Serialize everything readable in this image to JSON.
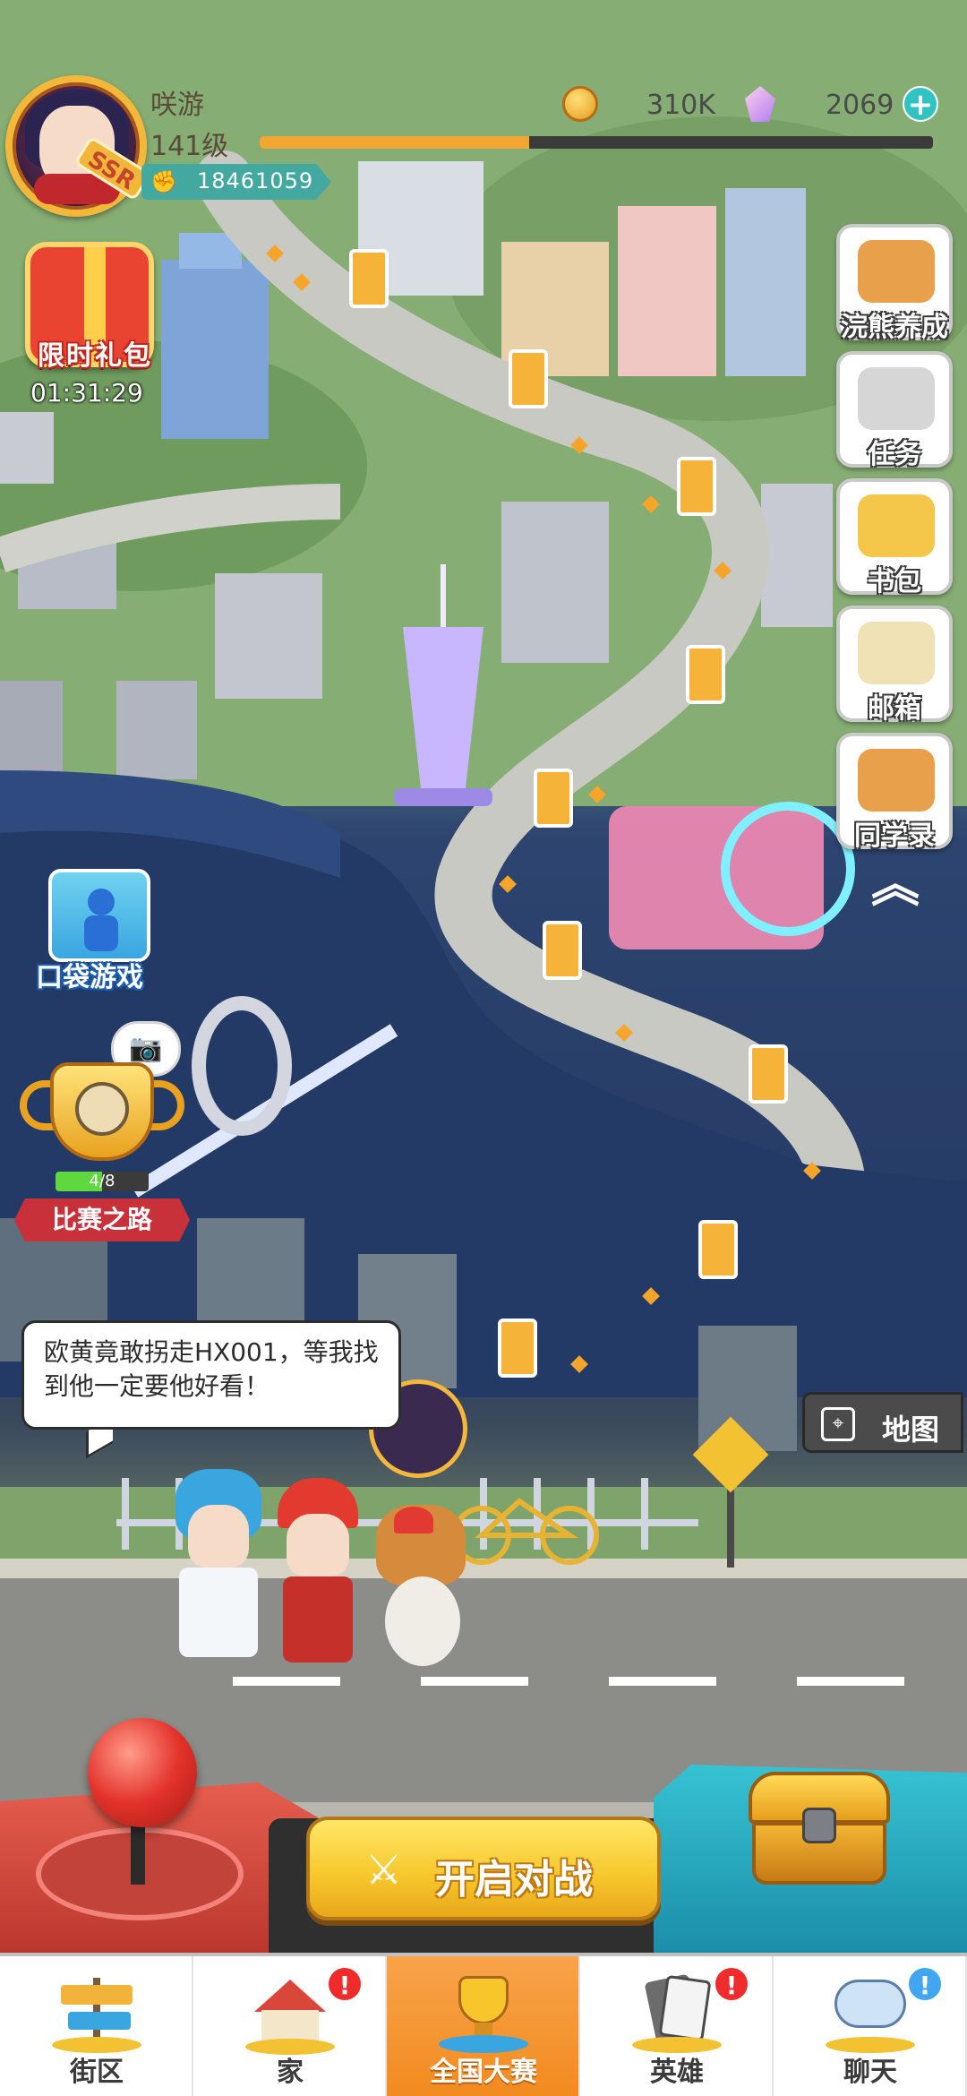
{
  "player": {
    "name": "咲游",
    "level": "141级",
    "power": "18461059",
    "xp_progress": 0.4,
    "ssr_badge": "SSR"
  },
  "currency": {
    "coins": "310K",
    "gems": "2069",
    "add_symbol": "+"
  },
  "gift": {
    "label": "限时礼包",
    "timer": "01:31:29"
  },
  "pocket_game": {
    "label": "口袋游戏"
  },
  "match_road": {
    "progress_text": "4/8",
    "progress": 0.5,
    "label": "比赛之路"
  },
  "side_menu": [
    {
      "label": "浣熊养成",
      "icon": "raccoon-icon",
      "color": "#e9a04a"
    },
    {
      "label": "任务",
      "icon": "clipboard-icon",
      "color": "#d6d6d6"
    },
    {
      "label": "书包",
      "icon": "backpack-icon",
      "color": "#f4c64a"
    },
    {
      "label": "邮箱",
      "icon": "envelope-icon",
      "color": "#f0e2b4"
    },
    {
      "label": "同学录",
      "icon": "raccoon-book-icon",
      "color": "#e9a04a"
    }
  ],
  "collapse_symbol": "︽",
  "dialog": {
    "text": "欧黄竟敢拐走HX001，等我找到他一定要他好看！"
  },
  "map_button": {
    "label": "地图",
    "icon_glyph": "⌖"
  },
  "battle": {
    "label": "开启对战",
    "icon_glyph": "⚔"
  },
  "camera_glyph": "📷",
  "power_glyph": "✊",
  "nav": [
    {
      "label": "街区",
      "icon": "signpost-icon",
      "badge": "",
      "active": false
    },
    {
      "label": "家",
      "icon": "house-icon",
      "badge": "!",
      "active": false
    },
    {
      "label": "全国大赛",
      "icon": "trophy-icon",
      "badge": "",
      "active": true
    },
    {
      "label": "英雄",
      "icon": "cards-icon",
      "badge": "!",
      "active": false
    },
    {
      "label": "聊天",
      "icon": "chat-bubble-icon",
      "badge": "!",
      "active": false
    }
  ],
  "colors": {
    "accent_orange": "#f3a632",
    "teal": "#43a9a0",
    "badge_red": "#ef2b2b",
    "badge_blue": "#41a6ef"
  }
}
